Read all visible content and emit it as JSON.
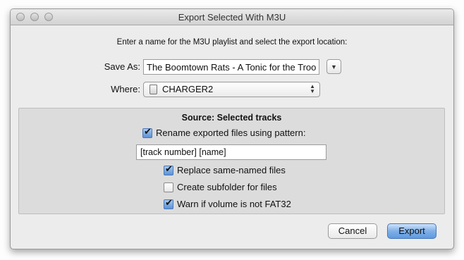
{
  "window": {
    "title": "Export Selected With M3U"
  },
  "instructions": "Enter a name for the M3U playlist and select the export location:",
  "save_as": {
    "label": "Save As:",
    "value": "The Boomtown Rats - A Tonic for the Troops",
    "disclosure_icon": "chevron-down-icon"
  },
  "where": {
    "label": "Where:",
    "value": "CHARGER2",
    "icon": "disk-icon"
  },
  "source": {
    "title": "Source: Selected tracks",
    "rename": {
      "label": "Rename exported files using pattern:",
      "checked": true
    },
    "pattern": "[track number] [name]",
    "options": [
      {
        "label": "Replace same-named files",
        "checked": true
      },
      {
        "label": "Create subfolder for files",
        "checked": false
      },
      {
        "label": "Warn if volume is not FAT32",
        "checked": true
      }
    ]
  },
  "buttons": {
    "cancel": "Cancel",
    "export": "Export"
  },
  "colors": {
    "accent": "#5f9ae0",
    "panel": "#dcdcdc",
    "window": "#ececec"
  }
}
